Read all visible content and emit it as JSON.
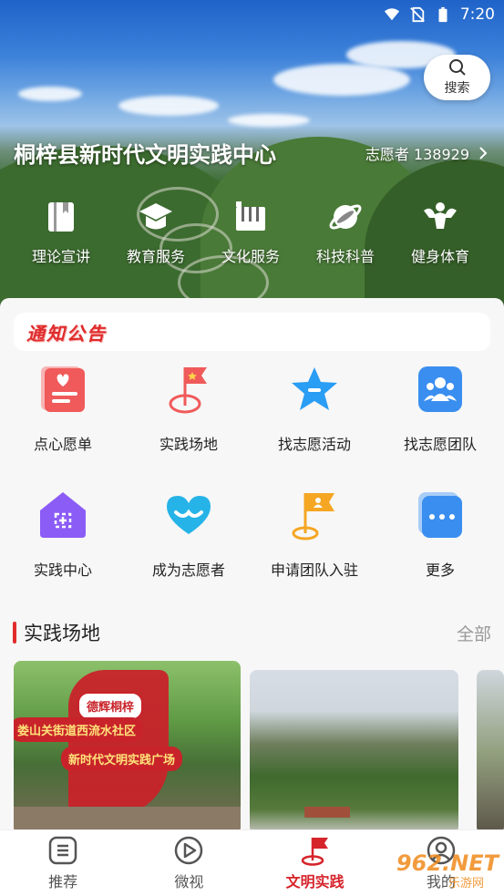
{
  "status_bar": {
    "time": "7:20"
  },
  "search": {
    "label": "搜索"
  },
  "hero": {
    "title": "桐梓县新时代文明实践中心",
    "volunteer": "志愿者 138929",
    "categories": [
      {
        "label": "理论宣讲",
        "icon": "book-icon"
      },
      {
        "label": "教育服务",
        "icon": "graduation-cap-icon"
      },
      {
        "label": "文化服务",
        "icon": "piano-icon"
      },
      {
        "label": "科技科普",
        "icon": "planet-icon"
      },
      {
        "label": "健身体育",
        "icon": "fitness-icon"
      }
    ]
  },
  "notice": {
    "label": "通知公告"
  },
  "services": [
    {
      "label": "点心愿单",
      "icon": "wish-list-icon",
      "color": "#f05a5a"
    },
    {
      "label": "实践场地",
      "icon": "location-flag-icon",
      "color": "#f05a5a"
    },
    {
      "label": "找志愿活动",
      "icon": "star-icon",
      "color": "#2a9df4"
    },
    {
      "label": "找志愿团队",
      "icon": "team-icon",
      "color": "#3a8ef0"
    },
    {
      "label": "实践中心",
      "icon": "home-center-icon",
      "color": "#8b5cf6"
    },
    {
      "label": "成为志愿者",
      "icon": "heart-icon",
      "color": "#26b3e8"
    },
    {
      "label": "申请团队入驻",
      "icon": "team-flag-icon",
      "color": "#f5a623"
    },
    {
      "label": "更多",
      "icon": "more-icon",
      "color": "#3a8ef0"
    }
  ],
  "section": {
    "title": "实践场地",
    "more": "全部"
  },
  "cards": [
    {
      "sign_top": "德辉桐梓",
      "sign_mid": "娄山关街道西流水社区",
      "sign_bot": "新时代文明实践广场"
    }
  ],
  "tabs": [
    {
      "label": "推荐",
      "icon": "list-icon"
    },
    {
      "label": "微视",
      "icon": "play-icon"
    },
    {
      "label": "文明实践",
      "icon": "flag-icon"
    },
    {
      "label": "我的",
      "icon": "user-icon"
    }
  ],
  "watermark": {
    "text": "962.NET",
    "sub": "乐游网"
  },
  "colors": {
    "accent": "#d6242b",
    "text": "#222222",
    "muted": "#999999"
  }
}
